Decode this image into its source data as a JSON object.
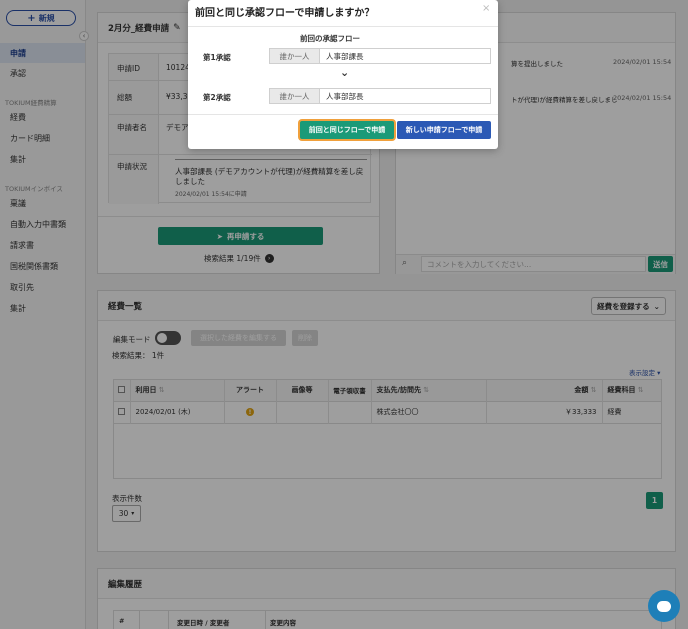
{
  "sidebar": {
    "new_button": "新規",
    "items": [
      {
        "label": "申請",
        "active": true
      },
      {
        "label": "承認"
      }
    ],
    "section1_title": "TOKIUM経費精算",
    "section1_items": [
      "経費",
      "カード明細",
      "集計"
    ],
    "section2_title": "TOKIUMインボイス",
    "section2_items": [
      "稟議",
      "自動入力中書類",
      "請求書",
      "国税関係書類",
      "取引先",
      "集計"
    ]
  },
  "report": {
    "title": "2月分_経費申請",
    "rows": [
      {
        "label": "申請ID",
        "value": "10124"
      },
      {
        "label": "総額",
        "value": "¥33,3"
      },
      {
        "label": "申請者名",
        "value": "デモア"
      }
    ],
    "status_label": "申請状況",
    "status_text": "人事部課長 (デモアカウントが代理)が経費精算を差し戻しました",
    "status_time": "2024/02/01 15:54に申請",
    "reapply_button": "再申請する",
    "search_result": "検索結果 1/19件"
  },
  "comments": {
    "items": [
      {
        "text": "算を提出しました",
        "time": "2024/02/01 15:54"
      },
      {
        "text": "トが代理)が経費精算を差し戻しまし",
        "time": "2024/02/01 15:54"
      }
    ],
    "placeholder": "コメントを入力してください...",
    "send_button": "送信"
  },
  "expenses": {
    "title": "経費一覧",
    "register_button": "経費を登録する",
    "edit_mode_label": "編集モード",
    "bulk_edit_button": "選択した経費を編集する",
    "delete_button": "削除",
    "search_count": "検索結果： 1件",
    "display_settings": "表示設定",
    "columns": [
      "利用日",
      "アラート",
      "画像等",
      "電子領収書",
      "支払先/訪問先",
      "金額",
      "経費科目"
    ],
    "rows": [
      {
        "date": "2024/02/01 (木)",
        "alert": "!",
        "image": "",
        "receipt": "",
        "payee": "株式会社〇〇",
        "amount": "￥33,333",
        "category": "経費"
      }
    ],
    "per_page_label": "表示件数",
    "per_page_value": "30",
    "page": "1"
  },
  "history": {
    "title": "編集履歴",
    "columns": [
      "#",
      "変更日時 / 変更者",
      "変更内容"
    ]
  },
  "modal": {
    "title": "前回と同じ承認フローで申請しますか？",
    "close": "×",
    "subtitle": "前回の承認フロー",
    "steps": [
      {
        "label": "第1承認",
        "prefix": "誰か一人",
        "value": "人事部課長"
      },
      {
        "label": "第2承認",
        "prefix": "誰か一人",
        "value": "人事部部長"
      }
    ],
    "same_flow_button": "前回と同じフローで申請",
    "new_flow_button": "新しい申請フローで申請"
  }
}
